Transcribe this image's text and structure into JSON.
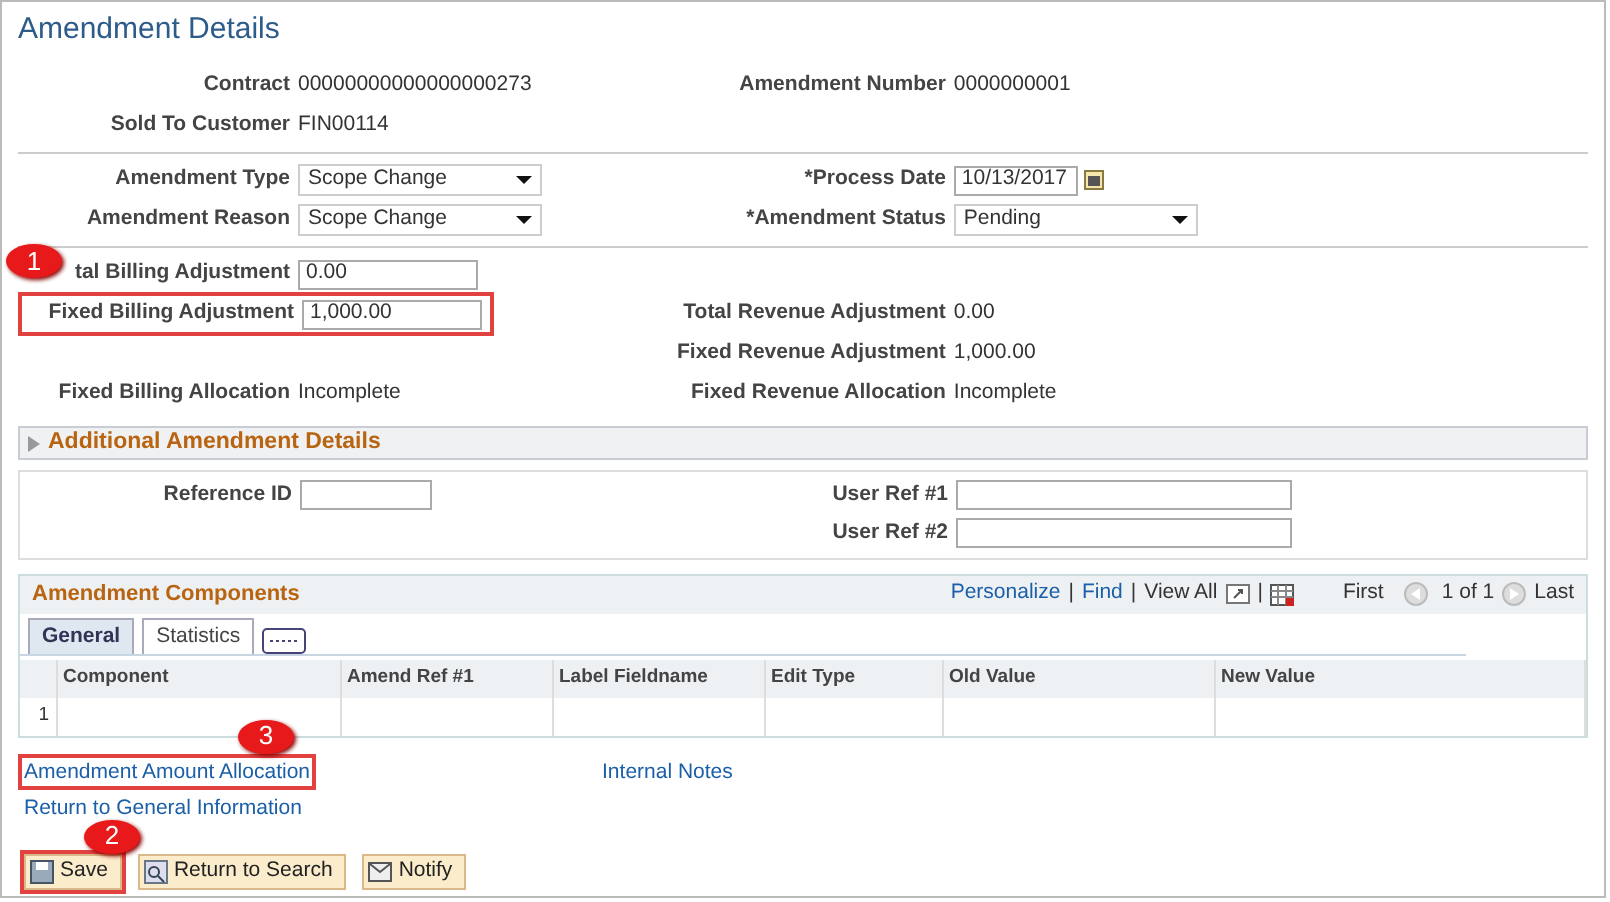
{
  "title": "Amendment Details",
  "sections": [
    [
      {
        "left": {
          "label": "Contract",
          "kind": "text",
          "value": "00000000000000000273",
          "highlighted": false
        },
        "right": {
          "label": "Amendment Number",
          "kind": "text",
          "value": "0000000001",
          "highlighted": false
        }
      },
      {
        "left": {
          "label": "Sold To Customer",
          "kind": "text",
          "value": "FIN00114",
          "highlighted": false
        }
      }
    ],
    [
      {
        "left": {
          "label": "Amendment Type",
          "kind": "select",
          "value": "Scope Change",
          "highlighted": false
        },
        "right": {
          "label": "*Process Date",
          "kind": "date",
          "value": "10/13/2017",
          "highlighted": false
        }
      },
      {
        "left": {
          "label": "Amendment Reason",
          "kind": "select",
          "value": "Scope Change",
          "highlighted": false
        },
        "right": {
          "label": "*Amendment Status",
          "kind": "select",
          "value": "Pending",
          "highlighted": false
        }
      }
    ],
    [
      {
        "left": {
          "label": "tal Billing Adjustment",
          "kind": "input",
          "value": "0.00",
          "highlighted": false,
          "callout": "1"
        }
      },
      {
        "left": {
          "label": "Fixed Billing Adjustment",
          "kind": "input",
          "value": "1,000.00",
          "highlighted": true
        },
        "right": {
          "label": "Total Revenue Adjustment",
          "kind": "text",
          "value": "0.00",
          "highlighted": false
        }
      },
      {
        "right": {
          "label": "Fixed Revenue Adjustment",
          "kind": "text",
          "value": "1,000.00",
          "highlighted": false
        }
      },
      {
        "left": {
          "label": "Fixed Billing Allocation",
          "kind": "text",
          "value": "Incomplete",
          "highlighted": false
        },
        "right": {
          "label": "Fixed Revenue Allocation",
          "kind": "text",
          "value": "Incomplete",
          "highlighted": false
        }
      }
    ]
  ],
  "collapsible": {
    "label": "Additional Amendment Details",
    "expanded": false
  },
  "references": [
    {
      "label": "Reference ID"
    },
    {
      "label": "User Ref #1"
    },
    {
      "label": "User Ref #2"
    }
  ],
  "components": {
    "title": "Amendment Components",
    "nav_items": [
      {
        "kind": "link",
        "label": "Personalize"
      },
      {
        "kind": "separator",
        "label": "|"
      },
      {
        "kind": "link",
        "label": "Find"
      },
      {
        "kind": "separator",
        "label": "|"
      },
      {
        "kind": "text",
        "label": "View All"
      },
      {
        "kind": "zoom"
      },
      {
        "kind": "separator",
        "label": "|"
      },
      {
        "kind": "download"
      }
    ],
    "pager": {
      "first": "First",
      "range": "1 of 1",
      "last": "Last"
    },
    "tabs": [
      {
        "label": "General",
        "selected": true
      },
      {
        "label": "Statistics",
        "selected": false
      }
    ],
    "columns": [
      "",
      "Component",
      "Amend Ref #1",
      "Label Fieldname",
      "Edit Type",
      "Old Value",
      "New Value"
    ],
    "rows": [
      [
        "1",
        "",
        "",
        "",
        "",
        "",
        ""
      ]
    ]
  },
  "links": [
    {
      "label": "Amendment Amount Allocation",
      "highlighted": true,
      "callout": "3"
    },
    {
      "label": "Internal Notes",
      "highlighted": false
    },
    {
      "label": "Return to General Information",
      "highlighted": false
    }
  ],
  "buttons": [
    {
      "label": "Save",
      "kind": "save",
      "highlighted": true,
      "callout": "2"
    },
    {
      "label": "Return to Search",
      "kind": "search",
      "highlighted": false
    },
    {
      "label": "Notify",
      "kind": "notify",
      "highlighted": false
    }
  ]
}
